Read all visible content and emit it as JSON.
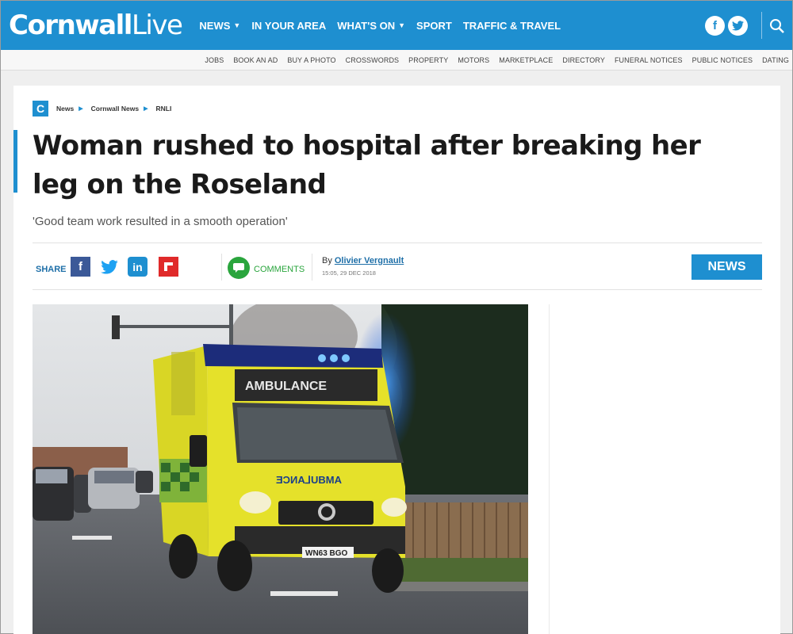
{
  "brand": {
    "logo_part1": "Cornwall",
    "logo_part2": "Live",
    "color": "#1e8fd0"
  },
  "main_nav": [
    {
      "label": "NEWS",
      "dropdown": true
    },
    {
      "label": "IN YOUR AREA",
      "dropdown": false
    },
    {
      "label": "WHAT'S ON",
      "dropdown": true
    },
    {
      "label": "SPORT",
      "dropdown": false
    },
    {
      "label": "TRAFFIC & TRAVEL",
      "dropdown": false
    }
  ],
  "social_header": {
    "facebook": "f",
    "twitter": "twitter-icon"
  },
  "sub_nav": [
    "JOBS",
    "BOOK AN AD",
    "BUY A PHOTO",
    "CROSSWORDS",
    "PROPERTY",
    "MOTORS",
    "MARKETPLACE",
    "DIRECTORY",
    "FUNERAL NOTICES",
    "PUBLIC NOTICES",
    "DATING"
  ],
  "breadcrumb": {
    "icon_letter": "C",
    "items": [
      "News",
      "Cornwall News",
      "RNLI"
    ]
  },
  "article": {
    "headline": "Woman rushed to hospital after breaking her leg on the Roseland",
    "standfirst": "'Good team work resulted in a smooth operation'",
    "share_label": "SHARE",
    "comments_label": "COMMENTS",
    "by_prefix": "By",
    "author": "Olivier Vergnault",
    "date": "15:05, 29 DEC 2018",
    "category_badge": "NEWS"
  },
  "photo": {
    "ambulance_front_text": "AMBULANCE",
    "ambulance_mirror_text": "ƎƆИA⅃UBMA",
    "number_plate": "WN63 BGO"
  }
}
